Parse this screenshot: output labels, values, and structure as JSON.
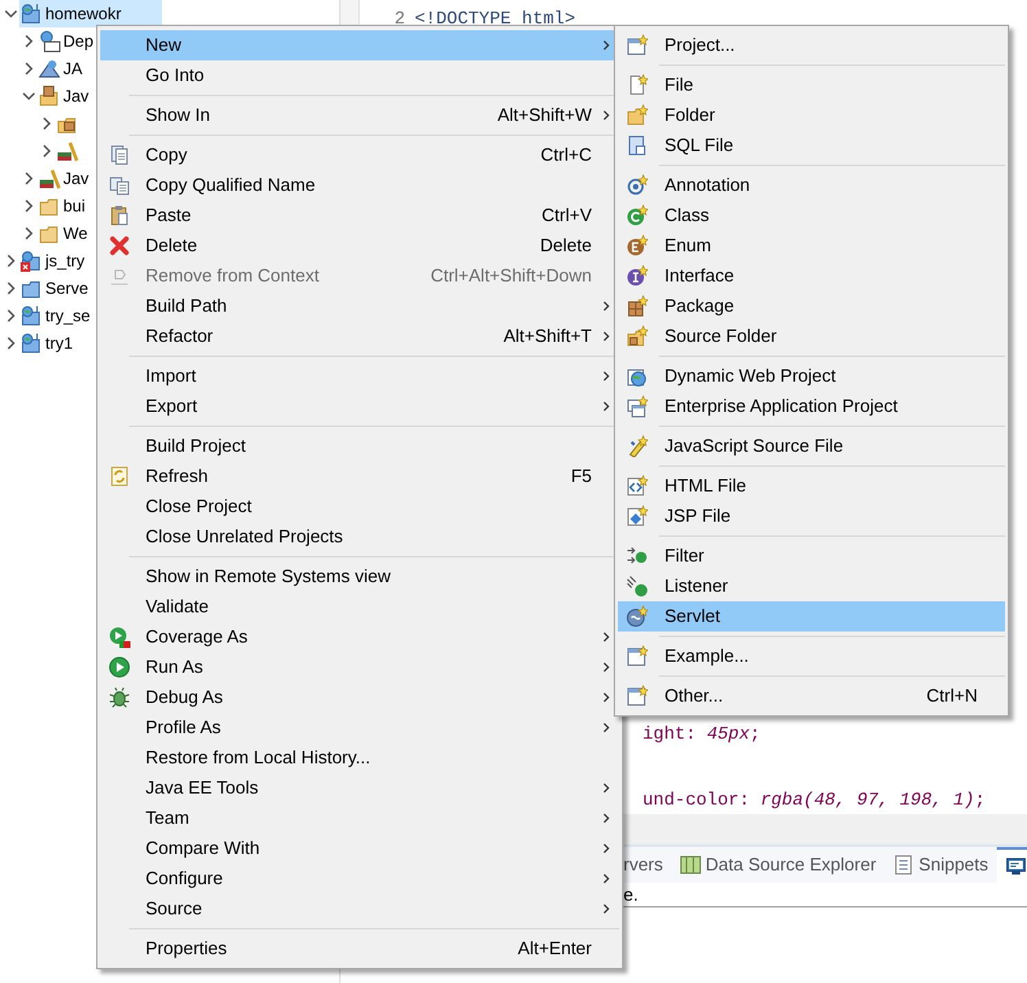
{
  "project_tree": [
    {
      "label": "homewokr",
      "expanded": true,
      "selected": true,
      "children": [
        {
          "label": "Dep",
          "expanded": false,
          "selected": false
        },
        {
          "label": "JA",
          "expanded": false,
          "selected": false
        },
        {
          "label": "Jav",
          "expanded": true,
          "selected": false,
          "children": [
            {
              "expanded": false,
              "selected": false
            },
            {
              "expanded": false,
              "selected": false
            }
          ]
        },
        {
          "label": "Jav",
          "expanded": false,
          "selected": false
        },
        {
          "label": "bui",
          "expanded": false,
          "selected": false
        },
        {
          "label": "We",
          "expanded": false,
          "selected": false
        }
      ]
    },
    {
      "label": "js_try",
      "expanded": false,
      "selected": false
    },
    {
      "label": "Serve",
      "expanded": false,
      "selected": false
    },
    {
      "label": "try_se",
      "expanded": false,
      "selected": false
    },
    {
      "label": "try1",
      "expanded": false,
      "selected": false
    }
  ],
  "editor": {
    "lines": [
      {
        "number": "2",
        "text": "<!DOCTYPE html>"
      }
    ],
    "fragments": [
      "ight: *45px*;",
      "und-color: *rgba(48, 97, 198, 1)*;"
    ]
  },
  "bottom_panel": {
    "tabs": [
      {
        "label": "rvers",
        "selected": false
      },
      {
        "label": "Data Source Explorer",
        "selected": false
      },
      {
        "label": "Snippets",
        "selected": false
      },
      {
        "selected": true
      }
    ],
    "content": "e."
  },
  "context_menu": {
    "items": [
      {
        "kind": "item",
        "label": "New",
        "submenu": true,
        "disabled": false,
        "selected": true
      },
      {
        "kind": "item",
        "label": "Go Into",
        "submenu": false,
        "disabled": false,
        "selected": false
      },
      {
        "kind": "separator"
      },
      {
        "kind": "item",
        "label": "Show In",
        "shortcut": "Alt+Shift+W",
        "submenu": true,
        "disabled": false,
        "selected": false
      },
      {
        "kind": "separator"
      },
      {
        "kind": "item",
        "label": "Copy",
        "shortcut": "Ctrl+C",
        "submenu": false,
        "disabled": false,
        "selected": false
      },
      {
        "kind": "item",
        "label": "Copy Qualified Name",
        "submenu": false,
        "disabled": false,
        "selected": false
      },
      {
        "kind": "item",
        "label": "Paste",
        "shortcut": "Ctrl+V",
        "submenu": false,
        "disabled": false,
        "selected": false
      },
      {
        "kind": "item",
        "label": "Delete",
        "shortcut": "Delete",
        "submenu": false,
        "disabled": false,
        "selected": false
      },
      {
        "kind": "item",
        "label": "Remove from Context",
        "shortcut": "Ctrl+Alt+Shift+Down",
        "submenu": false,
        "disabled": true,
        "selected": false
      },
      {
        "kind": "item",
        "label": "Build Path",
        "submenu": true,
        "disabled": false,
        "selected": false
      },
      {
        "kind": "item",
        "label": "Refactor",
        "shortcut": "Alt+Shift+T",
        "submenu": true,
        "disabled": false,
        "selected": false
      },
      {
        "kind": "separator"
      },
      {
        "kind": "item",
        "label": "Import",
        "submenu": true,
        "disabled": false,
        "selected": false
      },
      {
        "kind": "item",
        "label": "Export",
        "submenu": true,
        "disabled": false,
        "selected": false
      },
      {
        "kind": "separator"
      },
      {
        "kind": "item",
        "label": "Build Project",
        "submenu": false,
        "disabled": false,
        "selected": false
      },
      {
        "kind": "item",
        "label": "Refresh",
        "shortcut": "F5",
        "submenu": false,
        "disabled": false,
        "selected": false
      },
      {
        "kind": "item",
        "label": "Close Project",
        "submenu": false,
        "disabled": false,
        "selected": false
      },
      {
        "kind": "item",
        "label": "Close Unrelated Projects",
        "submenu": false,
        "disabled": false,
        "selected": false
      },
      {
        "kind": "separator"
      },
      {
        "kind": "item",
        "label": "Show in Remote Systems view",
        "submenu": false,
        "disabled": false,
        "selected": false
      },
      {
        "kind": "item",
        "label": "Validate",
        "submenu": false,
        "disabled": false,
        "selected": false
      },
      {
        "kind": "item",
        "label": "Coverage As",
        "submenu": true,
        "disabled": false,
        "selected": false
      },
      {
        "kind": "item",
        "label": "Run As",
        "submenu": true,
        "disabled": false,
        "selected": false
      },
      {
        "kind": "item",
        "label": "Debug As",
        "submenu": true,
        "disabled": false,
        "selected": false
      },
      {
        "kind": "item",
        "label": "Profile As",
        "submenu": true,
        "disabled": false,
        "selected": false
      },
      {
        "kind": "item",
        "label": "Restore from Local History...",
        "submenu": false,
        "disabled": false,
        "selected": false
      },
      {
        "kind": "item",
        "label": "Java EE Tools",
        "submenu": true,
        "disabled": false,
        "selected": false
      },
      {
        "kind": "item",
        "label": "Team",
        "submenu": true,
        "disabled": false,
        "selected": false
      },
      {
        "kind": "item",
        "label": "Compare With",
        "submenu": true,
        "disabled": false,
        "selected": false
      },
      {
        "kind": "item",
        "label": "Configure",
        "submenu": true,
        "disabled": false,
        "selected": false
      },
      {
        "kind": "item",
        "label": "Source",
        "submenu": true,
        "disabled": false,
        "selected": false
      },
      {
        "kind": "separator"
      },
      {
        "kind": "item",
        "label": "Properties",
        "shortcut": "Alt+Enter",
        "submenu": false,
        "disabled": false,
        "selected": false
      }
    ]
  },
  "new_submenu": {
    "items": [
      {
        "kind": "item",
        "label": "Project...",
        "selected": false
      },
      {
        "kind": "separator"
      },
      {
        "kind": "item",
        "label": "File",
        "selected": false
      },
      {
        "kind": "item",
        "label": "Folder",
        "selected": false
      },
      {
        "kind": "item",
        "label": "SQL File",
        "selected": false
      },
      {
        "kind": "separator"
      },
      {
        "kind": "item",
        "label": "Annotation",
        "selected": false
      },
      {
        "kind": "item",
        "label": "Class",
        "selected": false
      },
      {
        "kind": "item",
        "label": "Enum",
        "selected": false
      },
      {
        "kind": "item",
        "label": "Interface",
        "selected": false
      },
      {
        "kind": "item",
        "label": "Package",
        "selected": false
      },
      {
        "kind": "item",
        "label": "Source Folder",
        "selected": false
      },
      {
        "kind": "separator"
      },
      {
        "kind": "item",
        "label": "Dynamic Web Project",
        "selected": false
      },
      {
        "kind": "item",
        "label": "Enterprise Application Project",
        "selected": false
      },
      {
        "kind": "separator"
      },
      {
        "kind": "item",
        "label": "JavaScript Source File",
        "selected": false
      },
      {
        "kind": "separator"
      },
      {
        "kind": "item",
        "label": "HTML File",
        "selected": false
      },
      {
        "kind": "item",
        "label": "JSP File",
        "selected": false
      },
      {
        "kind": "separator"
      },
      {
        "kind": "item",
        "label": "Filter",
        "selected": false
      },
      {
        "kind": "item",
        "label": "Listener",
        "selected": false
      },
      {
        "kind": "item",
        "label": "Servlet",
        "selected": true
      },
      {
        "kind": "separator"
      },
      {
        "kind": "item",
        "label": "Example...",
        "selected": false
      },
      {
        "kind": "separator"
      },
      {
        "kind": "item",
        "label": "Other...",
        "shortcut": "Ctrl+N",
        "selected": false
      }
    ]
  }
}
